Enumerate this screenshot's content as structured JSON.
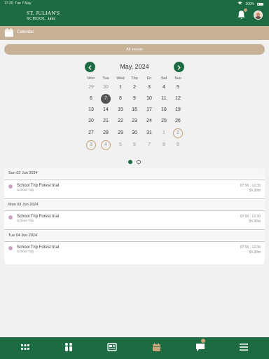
{
  "status_bar": {
    "time": "17:20",
    "date": "Tue 7 May",
    "battery": "100%"
  },
  "header": {
    "logo_line1": "St. Julian's",
    "logo_line2": "School",
    "logo_year": "1932"
  },
  "breadcrumb": {
    "label": "Calendar"
  },
  "filter": {
    "label": "All events"
  },
  "calendar": {
    "month_label": "May, 2024",
    "weekdays": [
      "Mon",
      "Tue",
      "Wed",
      "Thu",
      "Fri",
      "Sat",
      "Sun"
    ],
    "weeks": [
      [
        "29",
        "30",
        "1",
        "2",
        "3",
        "4",
        "5"
      ],
      [
        "6",
        "7",
        "8",
        "9",
        "10",
        "11",
        "12"
      ],
      [
        "13",
        "14",
        "15",
        "16",
        "17",
        "18",
        "19"
      ],
      [
        "20",
        "21",
        "22",
        "23",
        "24",
        "25",
        "26"
      ],
      [
        "27",
        "28",
        "29",
        "30",
        "31",
        "1",
        "2"
      ],
      [
        "3",
        "4",
        "5",
        "6",
        "7",
        "8",
        "9"
      ]
    ],
    "today": "7",
    "marked_days": [
      "2 Jun",
      "3 Jun",
      "4 Jun"
    ]
  },
  "pager": {
    "pages": 2,
    "current": 1
  },
  "event_days": [
    {
      "date": "Sun 02 Jun 2024",
      "events": [
        {
          "title": "School Trip Forest trial",
          "category": "School Trip",
          "time": "07:00 : 12:30",
          "duration": "5h 30m"
        }
      ]
    },
    {
      "date": "Mon 03 Jun 2024",
      "events": [
        {
          "title": "School Trip Forest trial",
          "category": "School Trip",
          "time": "07:00 : 12:30",
          "duration": "5h 30m"
        }
      ]
    },
    {
      "date": "Tue 04 Jun 2024",
      "events": [
        {
          "title": "School Trip Forest trial",
          "category": "School Trip",
          "time": "07:00 : 12:30",
          "duration": "5h 30m"
        }
      ]
    }
  ],
  "bottom_nav": {
    "items": [
      "dashboard-icon",
      "people-icon",
      "news-icon",
      "calendar-icon",
      "messages-icon",
      "menu-icon"
    ],
    "active": "calendar-icon"
  },
  "colors": {
    "primary": "#1d6b43",
    "accent": "#c7b298",
    "marker": "#c7a47a",
    "event_dot": "#c9a5c8"
  }
}
